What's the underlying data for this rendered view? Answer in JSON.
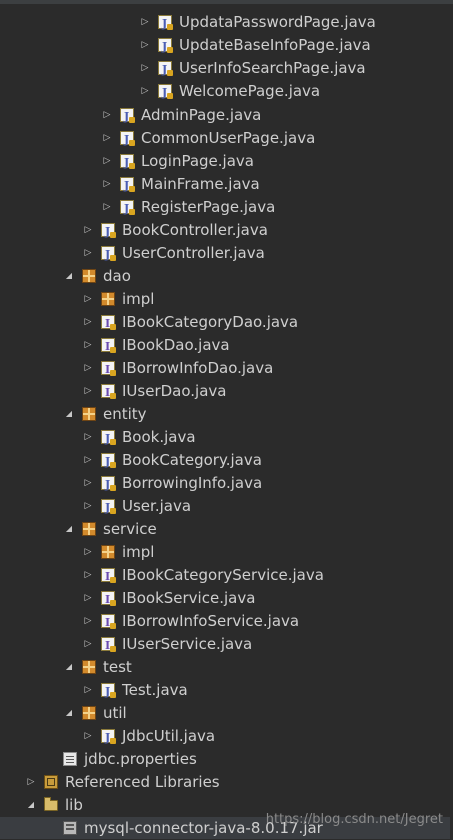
{
  "tree": [
    {
      "label": "UpdataPasswordPage.java",
      "icon": "java-class-icon",
      "expanded": false
    },
    {
      "label": "UpdateBaseInfoPage.java",
      "icon": "java-class-icon",
      "expanded": false
    },
    {
      "label": "UserInfoSearchPage.java",
      "icon": "java-class-icon",
      "expanded": false
    },
    {
      "label": "WelcomePage.java",
      "icon": "java-class-icon",
      "expanded": false
    },
    {
      "label": "AdminPage.java",
      "icon": "java-class-icon",
      "expanded": false
    },
    {
      "label": "CommonUserPage.java",
      "icon": "java-class-icon",
      "expanded": false
    },
    {
      "label": "LoginPage.java",
      "icon": "java-class-icon",
      "expanded": false
    },
    {
      "label": "MainFrame.java",
      "icon": "java-class-icon",
      "expanded": false
    },
    {
      "label": "RegisterPage.java",
      "icon": "java-class-icon",
      "expanded": false
    },
    {
      "label": "BookController.java",
      "icon": "java-class-icon",
      "expanded": false
    },
    {
      "label": "UserController.java",
      "icon": "java-class-icon",
      "expanded": false
    },
    {
      "label": "dao",
      "icon": "package-icon",
      "expanded": true
    },
    {
      "label": "impl",
      "icon": "package-icon",
      "expanded": false
    },
    {
      "label": "IBookCategoryDao.java",
      "icon": "java-interface-icon",
      "expanded": false
    },
    {
      "label": "IBookDao.java",
      "icon": "java-interface-icon",
      "expanded": false
    },
    {
      "label": "IBorrowInfoDao.java",
      "icon": "java-interface-icon",
      "expanded": false
    },
    {
      "label": "IUserDao.java",
      "icon": "java-interface-icon",
      "expanded": false
    },
    {
      "label": "entity",
      "icon": "package-icon",
      "expanded": true
    },
    {
      "label": "Book.java",
      "icon": "java-class-icon",
      "expanded": false
    },
    {
      "label": "BookCategory.java",
      "icon": "java-class-icon",
      "expanded": false
    },
    {
      "label": "BorrowingInfo.java",
      "icon": "java-class-icon",
      "expanded": false
    },
    {
      "label": "User.java",
      "icon": "java-class-icon",
      "expanded": false
    },
    {
      "label": "service",
      "icon": "package-icon",
      "expanded": true
    },
    {
      "label": "impl",
      "icon": "package-icon",
      "expanded": false
    },
    {
      "label": "IBookCategoryService.java",
      "icon": "java-interface-icon",
      "expanded": false
    },
    {
      "label": "IBookService.java",
      "icon": "java-interface-icon",
      "expanded": false
    },
    {
      "label": "IBorrowInfoService.java",
      "icon": "java-interface-icon",
      "expanded": false
    },
    {
      "label": "IUserService.java",
      "icon": "java-interface-icon",
      "expanded": false
    },
    {
      "label": "test",
      "icon": "package-icon",
      "expanded": true
    },
    {
      "label": "Test.java",
      "icon": "java-class-icon",
      "expanded": false
    },
    {
      "label": "util",
      "icon": "package-icon",
      "expanded": true
    },
    {
      "label": "JdbcUtil.java",
      "icon": "java-class-icon",
      "expanded": false
    },
    {
      "label": "jdbc.properties",
      "icon": "properties-file-icon",
      "expanded": null
    },
    {
      "label": "Referenced Libraries",
      "icon": "libraries-icon",
      "expanded": false
    },
    {
      "label": "lib",
      "icon": "folder-icon",
      "expanded": true
    },
    {
      "label": "mysql-connector-java-8.0.17.jar",
      "icon": "jar-icon",
      "expanded": null,
      "selected": true
    }
  ],
  "watermark": "https://blog.csdn.net/Jegret",
  "colors": {
    "background": "#2b2b2b",
    "text": "#cfcfcf",
    "selection": "#3a3d41"
  }
}
